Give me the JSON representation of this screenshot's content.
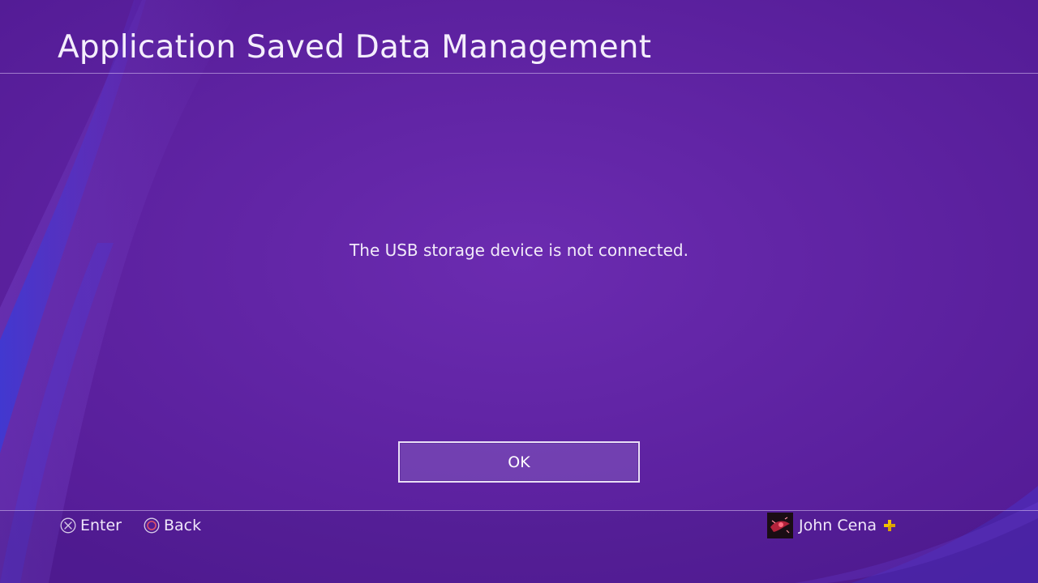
{
  "header": {
    "title": "Application Saved Data Management"
  },
  "dialog": {
    "message": "The USB storage device is not connected.",
    "ok_label": "OK"
  },
  "footer": {
    "hints": [
      {
        "icon": "cross-button-icon",
        "label": "Enter"
      },
      {
        "icon": "circle-button-icon",
        "label": "Back"
      }
    ],
    "user": {
      "name": "John Cena",
      "avatar": "avatar",
      "badge_icon": "ps-plus-icon"
    }
  },
  "colors": {
    "background": "#5a1f9e",
    "background_light": "#6a2aae",
    "wave_blue": "#3d3fd8",
    "plus_yellow": "#f2c200",
    "circle_red": "#e0506a"
  }
}
